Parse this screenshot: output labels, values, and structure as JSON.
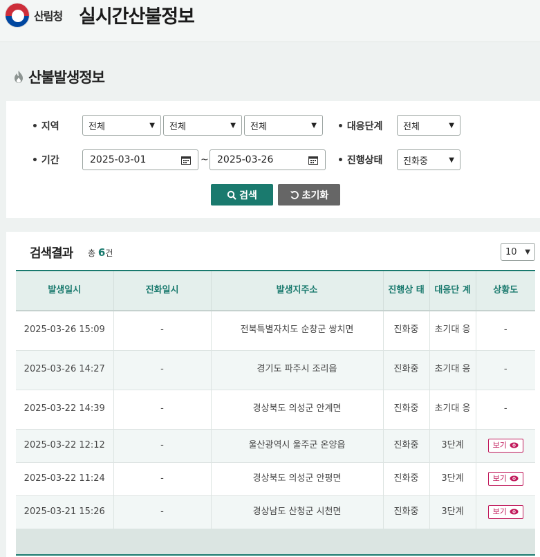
{
  "header": {
    "org_name": "산림청",
    "app_title": "실시간산불정보"
  },
  "section": {
    "title": "산불발생정보"
  },
  "search": {
    "region_label": "지역",
    "region_1": "전체",
    "region_2": "전체",
    "region_3": "전체",
    "response_level_label": "대응단계",
    "response_level_value": "전체",
    "period_label": "기간",
    "date_from": "2025-03-01",
    "date_to": "2025-03-26",
    "tilde": "~",
    "status_label": "진행상태",
    "status_value": "진화중",
    "search_button": "검색",
    "reset_button": "초기화"
  },
  "results": {
    "title": "검색결과",
    "total_prefix": "총",
    "total_count": "6",
    "total_suffix": "건",
    "page_size": "10",
    "columns": [
      "발생일시",
      "진화일시",
      "발생지주소",
      "진행상 태",
      "대응단 계",
      "상황도"
    ],
    "view_label": "보기",
    "rows": [
      {
        "occurred": "2025-03-26 15:09",
        "extinguished": "-",
        "address": "전북특별자치도 순창군 쌍치면",
        "status": "진화중",
        "level": "초기대 응",
        "map": "-"
      },
      {
        "occurred": "2025-03-26 14:27",
        "extinguished": "-",
        "address": "경기도 파주시 조리읍",
        "status": "진화중",
        "level": "초기대 응",
        "map": "-"
      },
      {
        "occurred": "2025-03-22 14:39",
        "extinguished": "-",
        "address": "경상북도 의성군 안계면",
        "status": "진화중",
        "level": "초기대 응",
        "map": "-"
      },
      {
        "occurred": "2025-03-22 12:12",
        "extinguished": "-",
        "address": "울산광역시 울주군 온양읍",
        "status": "진화중",
        "level": "3단계",
        "map": "보기"
      },
      {
        "occurred": "2025-03-22 11:24",
        "extinguished": "-",
        "address": "경상북도 의성군 안평면",
        "status": "진화중",
        "level": "3단계",
        "map": "보기"
      },
      {
        "occurred": "2025-03-21 15:26",
        "extinguished": "-",
        "address": "경상남도 산청군 시천면",
        "status": "진화중",
        "level": "3단계",
        "map": "보기"
      }
    ]
  },
  "colors": {
    "accent": "#1a7a6e",
    "view_button": "#c0185a",
    "reset_button": "#666666"
  }
}
